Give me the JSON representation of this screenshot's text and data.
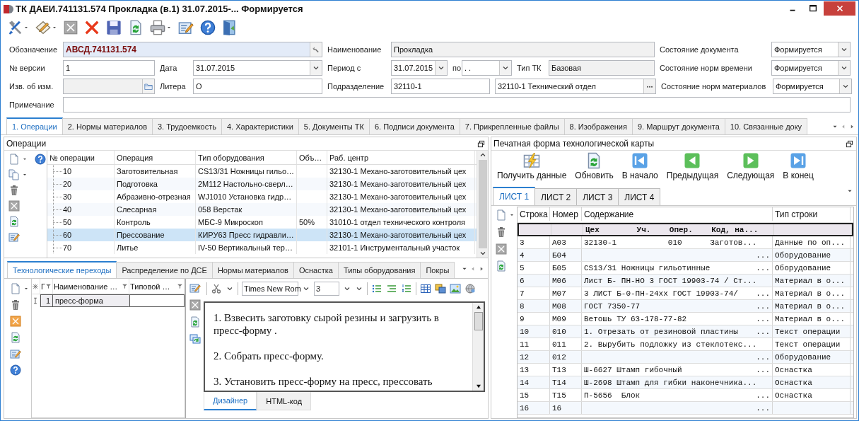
{
  "window": {
    "title": "ТК ДАЕИ.741131.574 Прокладка (в.1) 31.07.2015-... Формируется"
  },
  "form": {
    "fields": [
      {
        "label": "Обозначение",
        "value": "АВСД.741131.574",
        "kind": "lookup",
        "readonly": false
      },
      {
        "label": "Наименование",
        "value": "Прокладка",
        "kind": "text",
        "readonly": true
      },
      {
        "label": "Состояние документа",
        "value": "Формируется",
        "kind": "combo",
        "readonly": false
      },
      {
        "label": "№ версии",
        "value": "1",
        "kind": "text",
        "readonly": false
      },
      {
        "label": "Дата",
        "value": "31.07.2015",
        "kind": "combo",
        "readonly": false
      },
      {
        "label": "Период с",
        "value": "31.07.2015",
        "kind": "combo",
        "readonly": false
      },
      {
        "label": "по",
        "value": ". .",
        "kind": "combo",
        "readonly": false
      },
      {
        "label": "Тип ТК",
        "value": "Базовая",
        "kind": "text",
        "readonly": true
      },
      {
        "label": "Состояние норм времени",
        "value": "Формируется",
        "kind": "combo",
        "readonly": false
      },
      {
        "label": "Изв. об изм.",
        "kind": "folder",
        "readonly": true
      },
      {
        "label": "Литера",
        "value": "О",
        "kind": "text",
        "readonly": false
      },
      {
        "label": "Подразделение",
        "value": "32110-1",
        "kind": "text",
        "readonly": false
      },
      {
        "value": "32110-1 Технический отдел",
        "kind": "ellipsis",
        "readonly": false
      },
      {
        "label": "Состояние норм материалов",
        "value": "Формируется",
        "kind": "combo",
        "readonly": false
      },
      {
        "label": "Примечание",
        "kind": "text",
        "readonly": false
      }
    ]
  },
  "tabs": [
    {
      "label": "1. Операции",
      "selected": true
    },
    {
      "label": "2. Нормы материалов",
      "selected": false
    },
    {
      "label": "3. Трудоемкость",
      "selected": false
    },
    {
      "label": "4. Характеристики",
      "selected": false
    },
    {
      "label": "5. Документы ТК",
      "selected": false
    },
    {
      "label": "6. Подписи документа",
      "selected": false
    },
    {
      "label": "7. Прикрепленные файлы",
      "selected": false
    },
    {
      "label": "8. Изображения",
      "selected": false
    },
    {
      "label": "9. Маршрут документа",
      "selected": false
    },
    {
      "label": "10. Связанные доку",
      "selected": false
    }
  ],
  "operations": {
    "title": "Операции",
    "columns": [
      "№ операции",
      "Операция",
      "Тип оборудования",
      "Объ…",
      "Раб. центр"
    ],
    "rows": [
      {
        "number": "10",
        "operation": "Заготовительная",
        "equipment": "CS13/31 Ножницы гильо…",
        "work_center": "32130-1 Механо-заготовительный цех",
        "selected": false
      },
      {
        "number": "20",
        "operation": "Подготовка",
        "equipment": "2М112 Настольно-сверл…",
        "work_center": "32130-1 Механо-заготовительный цех",
        "selected": false
      },
      {
        "number": "30",
        "operation": "Абразивно-отрезная",
        "equipment": "WJ1010 Установка гидр…",
        "work_center": "32130-1 Механо-заготовительный цех",
        "selected": false
      },
      {
        "number": "40",
        "operation": "Слесарная",
        "equipment": "058 Верстак",
        "work_center": "32130-1 Механо-заготовительный цех",
        "selected": false
      },
      {
        "number": "50",
        "operation": "Контроль",
        "equipment": "МБС-9 Микроскоп",
        "column_4": "50%",
        "work_center": "31010-1 отдел технического контроля",
        "selected": false
      },
      {
        "number": "60",
        "operation": "Прессование",
        "equipment": "КИРУ63 Пресс гидравли…",
        "work_center": "32130-1 Механо-заготовительный цех",
        "selected": true
      },
      {
        "number": "70",
        "operation": "Литье",
        "equipment": "IV-50 Вертикальный тер…",
        "work_center": "32101-1 Инструментальный участок",
        "selected": false
      }
    ]
  },
  "bottom_tabs": [
    {
      "label": "Технологические переходы",
      "selected": true
    },
    {
      "label": "Распределение по ДСЕ",
      "selected": false
    },
    {
      "label": "Нормы материалов",
      "selected": false
    },
    {
      "label": "Оснастка",
      "selected": false
    },
    {
      "label": "Типы оборудования",
      "selected": false
    },
    {
      "label": "Покры",
      "selected": false
    }
  ],
  "transitions": {
    "columns": [
      "Г",
      "Наименование …",
      "Типовой …"
    ],
    "rows": [
      {
        "number": "1",
        "name": "пресс-форма"
      }
    ]
  },
  "editor": {
    "font": "Times New Rom",
    "size": "3",
    "paragraphs": [
      "1. Взвесить заготовку сырой резины и загрузить в пресс-форму .",
      "2. Собрать пресс-форму.",
      "3. Установить пресс-форму на пресс, прессовать"
    ],
    "tabs": [
      {
        "label": "Дизайнер",
        "selected": true
      },
      {
        "label": "HTML-код",
        "selected": false
      }
    ]
  },
  "print_form": {
    "title": "Печатная форма технологической карты",
    "actions": [
      {
        "label": "Получить данные",
        "kind": "data"
      },
      {
        "label": "Обновить",
        "kind": "refresh"
      },
      {
        "label": "В начало",
        "kind": "first"
      },
      {
        "label": "Предыдущая",
        "kind": "prev"
      },
      {
        "label": "Следующая",
        "kind": "next"
      },
      {
        "label": "В конец",
        "kind": "last"
      }
    ],
    "sheets": [
      {
        "label": "ЛИСТ 1",
        "selected": true
      },
      {
        "label": "ЛИСТ 2",
        "selected": false
      },
      {
        "label": "ЛИСТ 3",
        "selected": false
      },
      {
        "label": "ЛИСТ 4",
        "selected": false
      }
    ],
    "columns": [
      "Строка",
      "Номер",
      "Содержание",
      "Тип строки"
    ],
    "rows": [
      {
        "content": "Цех        Уч.    Опер.    Код, на...",
        "selected": true
      },
      {
        "line": "3",
        "number": "А03",
        "content": "32130-1           010      Заготов...",
        "type": "Данные по оп...",
        "selected": false
      },
      {
        "line": "4",
        "number": "Б04",
        "overflow": "...",
        "type": "Оборудование",
        "selected": false
      },
      {
        "line": "5",
        "number": "Б05",
        "content": "CS13/31 Ножницы гильотинные",
        "overflow": "...",
        "type": "Оборудование",
        "selected": false
      },
      {
        "line": "6",
        "number": "М06",
        "content": "Лист Б- ПН-НО 3 ГОСТ 19903-74 / Ст...",
        "type": "Материал в о...",
        "selected": false
      },
      {
        "line": "7",
        "number": "М07",
        "content": "3 ЛИСТ Б-0-ПН-24хх ГОСТ 19903-74/",
        "overflow": "...",
        "type": "Материал в о...",
        "selected": false
      },
      {
        "line": "8",
        "number": "М08",
        "content": "ГОСТ 7350-77",
        "overflow": "...",
        "type": "Материал в о...",
        "selected": false
      },
      {
        "line": "9",
        "number": "М09",
        "content": "Ветошь ТУ 63-178-77-82",
        "overflow": "...",
        "type": "Материал в о...",
        "selected": false
      },
      {
        "line": "10",
        "number": "010",
        "content": "1. Отрезать от резиновой пластины",
        "overflow": "...",
        "type": "Текст операции",
        "selected": false
      },
      {
        "line": "11",
        "number": "011",
        "content": "2. Вырубить подложку из стеклотекс...",
        "type": "Текст операции",
        "selected": false
      },
      {
        "line": "12",
        "number": "012",
        "overflow": "...",
        "type": "Оборудование",
        "selected": false
      },
      {
        "line": "13",
        "number": "Т13",
        "content": "Ш-6627 Штамп гибочный",
        "overflow": "...",
        "type": "Оснастка",
        "selected": false
      },
      {
        "line": "14",
        "number": "Т14",
        "content": "Ш-2698 Штамп для гибки наконечника...",
        "type": "Оснастка",
        "selected": false
      },
      {
        "line": "15",
        "number": "Т15",
        "content": "П-5656  Блок",
        "overflow": "...",
        "type": "Оснастка",
        "selected": false
      },
      {
        "line": "16",
        "number": "16",
        "overflow": "...",
        "selected": false
      }
    ]
  }
}
